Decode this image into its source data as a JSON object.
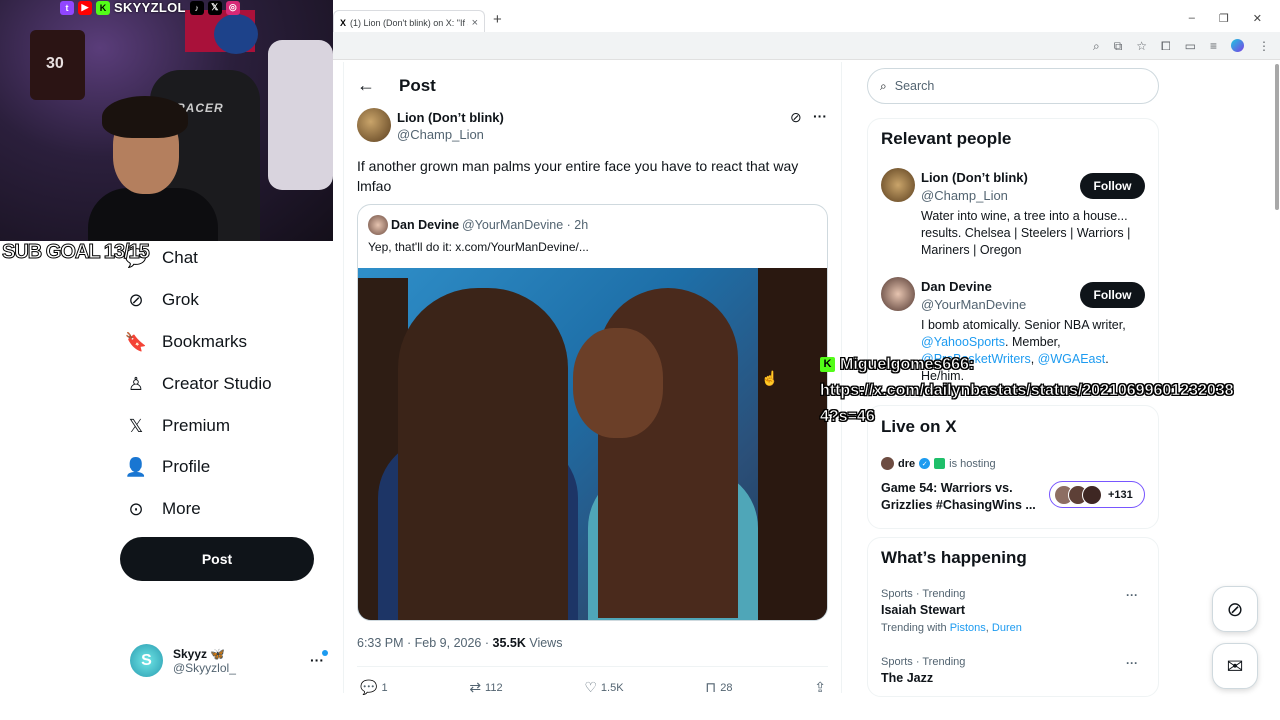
{
  "browser": {
    "tab_title": "(1) Lion (Don't blink) on X: \"If a",
    "tab_logo": "X",
    "tab_close": "×",
    "new_tab": "+",
    "window_controls": [
      "–",
      "❐",
      "✕"
    ]
  },
  "stream_overlay": {
    "social_handle": "SKYYZLOL",
    "sub_goal": "SUB GOAL 13/15",
    "chair_brand": "RACER",
    "jersey_number": "30",
    "chat_user": "Miguelgomes666:",
    "chat_message_line1": "https://x.com/dailynbastats/status/20210699601232038",
    "chat_message_line2": "4?s=46"
  },
  "sidebar": {
    "items": [
      {
        "label": "Chat",
        "icon": "chat-icon"
      },
      {
        "label": "Grok",
        "icon": "grok-icon"
      },
      {
        "label": "Bookmarks",
        "icon": "bookmark-icon"
      },
      {
        "label": "Creator Studio",
        "icon": "creator-studio-icon"
      },
      {
        "label": "Premium",
        "icon": "x-premium-icon"
      },
      {
        "label": "Profile",
        "icon": "profile-icon"
      },
      {
        "label": "More",
        "icon": "more-circle-icon"
      }
    ],
    "post_button": "Post",
    "account": {
      "name": "Skyyz 🦋",
      "handle": "@Skyyzlol_",
      "avatar_letter": "S"
    }
  },
  "main": {
    "header_title": "Post",
    "author_name": "Lion (Don’t blink)",
    "author_handle": "@Champ_Lion",
    "post_text": "If another grown man palms your entire face you have to react that way lmfao",
    "quote": {
      "name": "Dan Devine",
      "handle": "@YourManDevine · 2h",
      "text": "Yep, that'll do it:  x.com/YourManDevine/..."
    },
    "timestamp": "6:33 PM · Feb 9, 2026 · ",
    "views_count": "35.5K",
    "views_label": " Views",
    "actions": {
      "replies": "1",
      "reposts": "112",
      "likes": "1.5K",
      "bookmarks": "28"
    }
  },
  "right": {
    "search_placeholder": "Search",
    "relevant_title": "Relevant people",
    "people": [
      {
        "name": "Lion (Don’t blink)",
        "handle": "@Champ_Lion",
        "follow": "Follow",
        "bio": "Water into wine, a tree into a house... results. Chelsea | Steelers | Warriors | Mariners | Oregon"
      },
      {
        "name": "Dan Devine",
        "handle": "@YourManDevine",
        "follow": "Follow",
        "bio_text": "I bomb atomically. Senior NBA writer, ",
        "bio_link1": "@YahooSports",
        "bio_mid": ". Member, ",
        "bio_link2": "@ProBasketWriters",
        "bio_sep": ", ",
        "bio_link3": "@WGAEast",
        "bio_end": ". He/him."
      }
    ],
    "live": {
      "title": "Live on X",
      "host": "dre",
      "hosting": "is hosting",
      "event": "Game 54: Warriors vs. Grizzlies #ChasingWins ...",
      "listeners": "+131"
    },
    "happening": {
      "title": "What’s happening",
      "trends": [
        {
          "category": "Sports · Trending",
          "name": "Isaiah Stewart",
          "with": "Trending with ",
          "link1": "Pistons",
          "sep": ", ",
          "link2": "Duren"
        },
        {
          "category": "Sports · Trending",
          "name": "The Jazz"
        }
      ]
    }
  },
  "colors": {
    "accent": "#1d9bf0",
    "text": "#0f1419",
    "muted": "#536471",
    "kick_green": "#53fc18"
  }
}
